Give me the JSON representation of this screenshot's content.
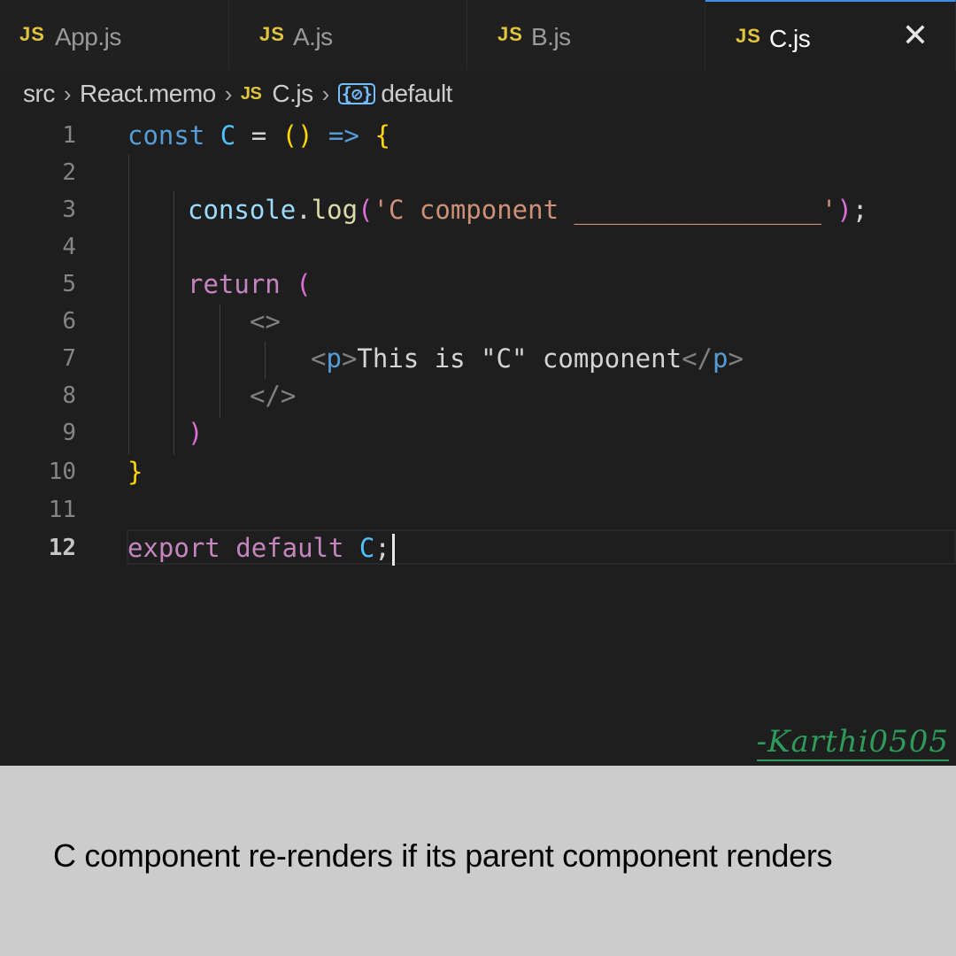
{
  "tabs": [
    {
      "badge": "JS",
      "name": "App.js"
    },
    {
      "badge": "JS",
      "name": "A.js"
    },
    {
      "badge": "JS",
      "name": "B.js"
    },
    {
      "badge": "JS",
      "name": "C.js",
      "close": "✕"
    }
  ],
  "breadcrumb": {
    "folder": "src",
    "subfolder": "React.memo",
    "file_badge": "JS",
    "file": "C.js",
    "symbol_icon": "{⊘}",
    "symbol": "default",
    "separator": "›"
  },
  "editor": {
    "line_numbers": [
      "1",
      "2",
      "3",
      "4",
      "5",
      "6",
      "7",
      "8",
      "9",
      "10",
      "11",
      "12"
    ],
    "current_line": "12",
    "lines": {
      "l1": {
        "kw": "const",
        "var": "C",
        "op": "=",
        "paren": "()",
        "arrow": "=>",
        "brace": "{"
      },
      "l3": {
        "obj": "console",
        "dot": ".",
        "fn": "log",
        "paren_open": "(",
        "str": "'C component ________________'",
        "paren_close": ")",
        "semi": ";"
      },
      "l5": {
        "kw": "return",
        "paren": "("
      },
      "l6": {
        "tag": "<>"
      },
      "l7": {
        "open_lt": "<",
        "open_name": "p",
        "open_gt": ">",
        "text": "This is \"C\" component",
        "close_lt": "</",
        "close_name": "p",
        "close_gt": ">"
      },
      "l8": {
        "tag": "</>"
      },
      "l9": {
        "paren": ")"
      },
      "l10": {
        "brace": "}"
      },
      "l12": {
        "kw1": "export",
        "kw2": "default",
        "var": "C",
        "semi": ";"
      }
    }
  },
  "watermark": "-Karthi0505",
  "caption": "C component re-renders if its parent component renders"
}
